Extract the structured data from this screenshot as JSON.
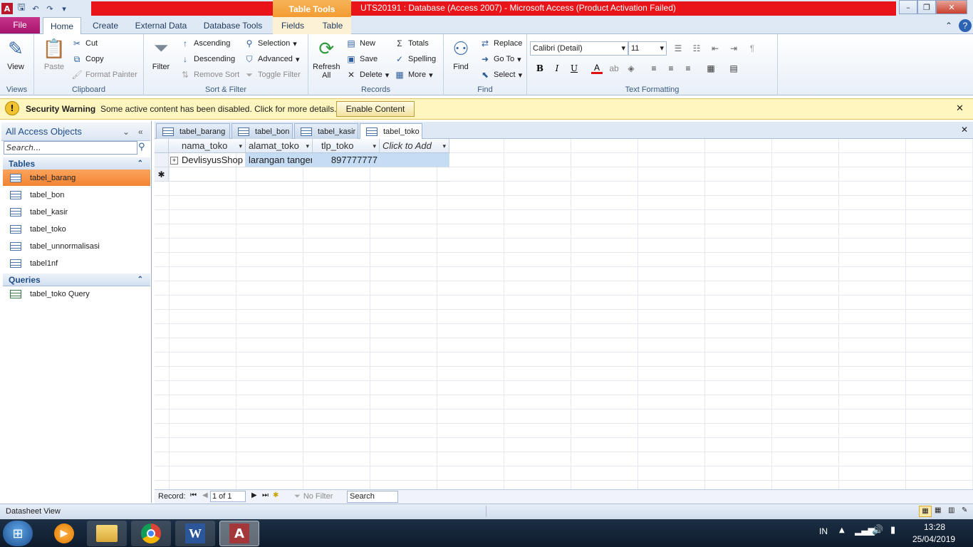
{
  "window": {
    "title": "UTS20191 : Database (Access 2007)  -  Microsoft Access (Product Activation Failed)",
    "context_group": "Table Tools",
    "controls": {
      "minimize": "–",
      "maximize": "❐",
      "close": "✕"
    }
  },
  "ribbon_tabs": {
    "file": "File",
    "home": "Home",
    "create": "Create",
    "external": "External Data",
    "dbtools": "Database Tools",
    "fields": "Fields",
    "table": "Table"
  },
  "ribbon": {
    "views": {
      "label": "Views",
      "view": "View"
    },
    "clipboard": {
      "label": "Clipboard",
      "paste": "Paste",
      "cut": "Cut",
      "copy": "Copy",
      "format_painter": "Format Painter"
    },
    "sort_filter": {
      "label": "Sort & Filter",
      "filter": "Filter",
      "ascending": "Ascending",
      "descending": "Descending",
      "remove_sort": "Remove Sort",
      "selection": "Selection",
      "advanced": "Advanced",
      "toggle_filter": "Toggle Filter"
    },
    "records": {
      "label": "Records",
      "refresh": "Refresh",
      "refresh2": "All",
      "new": "New",
      "save": "Save",
      "delete": "Delete",
      "totals": "Totals",
      "spelling": "Spelling",
      "more": "More"
    },
    "find": {
      "label": "Find",
      "find": "Find",
      "replace": "Replace",
      "goto": "Go To",
      "select": "Select"
    },
    "text_formatting": {
      "label": "Text Formatting",
      "font": "Calibri (Detail)",
      "size": "11"
    }
  },
  "security": {
    "title": "Security Warning",
    "message": "Some active content has been disabled. Click for more details.",
    "button": "Enable Content",
    "close": "✕"
  },
  "nav": {
    "header": "All Access Objects",
    "search_placeholder": "Search...",
    "tables_label": "Tables",
    "tables": [
      "tabel_barang",
      "tabel_bon",
      "tabel_kasir",
      "tabel_toko",
      "tabel_unnormalisasi",
      "tabel1nf"
    ],
    "queries_label": "Queries",
    "queries": [
      "tabel_toko Query"
    ]
  },
  "doc_tabs": [
    "tabel_barang",
    "tabel_bon",
    "tabel_kasir",
    "tabel_toko"
  ],
  "doc_close": "✕",
  "datasheet": {
    "columns": [
      "nama_toko",
      "alamat_toko",
      "tlp_toko",
      "Click to Add"
    ],
    "rows": [
      [
        "DevlisyusShop",
        "larangan tangerang",
        "897777777",
        ""
      ]
    ],
    "new_row_marker": "✱"
  },
  "record_nav": {
    "label": "Record:",
    "position": "1 of 1",
    "filter": "No Filter",
    "search": "Search"
  },
  "status": {
    "text": "Datasheet View"
  },
  "taskbar": {
    "lang": "IN",
    "time": "13:28",
    "date": "25/04/2019"
  },
  "colors": {
    "accent_red": "#e8141a",
    "selected_nav": "#f79646",
    "file_tab": "#b61d77"
  }
}
